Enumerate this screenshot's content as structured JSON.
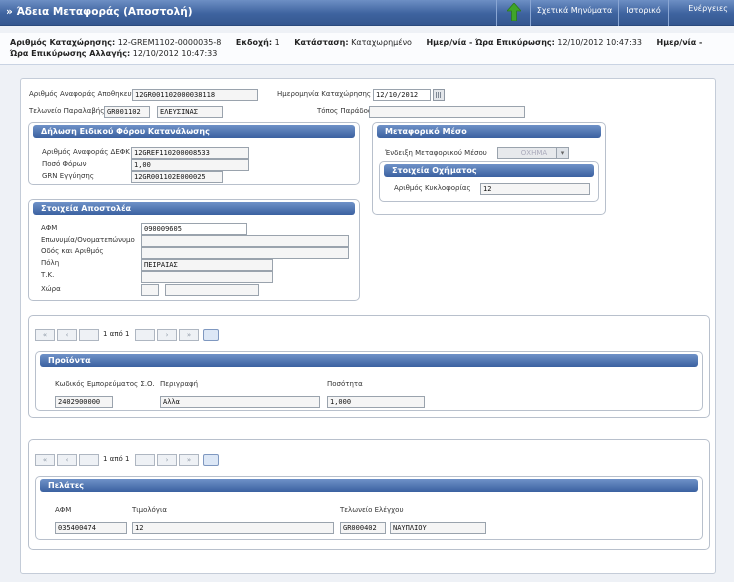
{
  "window": {
    "title": "» Άδεια Μεταφοράς (Αποστολή)",
    "toolbar": {
      "messages": "Σχετικά Μηνύματα",
      "history": "Ιστορικό",
      "actions": "Ενέργειες"
    }
  },
  "info": {
    "reg_no_label": "Αριθμός Καταχώρησης:",
    "reg_no": "12-GREM1102-0000035-8",
    "version_label": "Εκδοχή:",
    "version": "1",
    "status_label": "Κατάσταση:",
    "status": "Καταχωρημένο",
    "reg_date_label": "Ημερ/νία - Ώρα Επικύρωσης:",
    "reg_date": "12/10/2012 10:47:33",
    "mod_label_a": "Ημερ/νία -",
    "mod_label_b": "Ώρα Επικύρωσης Αλλαγής:",
    "mod_date": "12/10/2012 10:47:33"
  },
  "header": {
    "warehouse_ref_label": "Αριθμός Αναφοράς Αποθηκευτή",
    "warehouse_ref": "12GR001102000038118",
    "reg_date_label": "Ημερομηνία Καταχώρησης",
    "reg_date": "12/10/2012",
    "customs_label": "Τελωνείο Παραλαβής",
    "customs_code": "GR001102",
    "customs_name": "ΕΛΕΥΣΙΝΑΣ",
    "place_label": "Τόπος Παράδοσης",
    "place": ""
  },
  "tax": {
    "title": "Δήλωση Ειδικού Φόρου Κατανάλωσης",
    "ref_label": "Αριθμός Αναφοράς ΔΕΦΚ",
    "ref": "12GREF110200008533",
    "amount_label": "Ποσό Φόρων",
    "amount": "1,00",
    "grn_label": "GRN Εγγύησης",
    "grn": "12GR001102E000025"
  },
  "transport": {
    "title": "Μεταφορικό Μέσο",
    "means_label": "Ένδειξη Μεταφορικού Μέσου",
    "means": "ΟΧΗΜΑ",
    "vehicle_title": "Στοιχεία Οχήματος",
    "plate_label": "Αριθμός Κυκλοφορίας",
    "plate": "12"
  },
  "sender": {
    "title": "Στοιχεία Αποστολέα",
    "afm_label": "ΑΦΜ",
    "afm": "090009605",
    "name_label": "Επωνυμία/Ονοματεπώνυμο",
    "name": "",
    "street_label": "Οδός και Αριθμός",
    "street": "",
    "city_label": "Πόλη",
    "city": "ΠΕΙΡΑΙΑΣ",
    "zip_label": "Τ.Κ.",
    "zip": "",
    "country_label": "Χώρα",
    "country_code": "",
    "country_name": ""
  },
  "products": {
    "pager": {
      "first": "«",
      "prev": "‹",
      "page": "1 από 1",
      "next": "›",
      "last": "»"
    },
    "title": "Προϊόντα",
    "col_code": "Κωδικός Εμπορεύματος Σ.Ο.",
    "col_desc": "Περιγραφή",
    "col_qty": "Ποσότητα",
    "rows": [
      {
        "code": "2402900000",
        "desc": "Αλλα",
        "qty": "1,000"
      }
    ]
  },
  "clients": {
    "pager": {
      "first": "«",
      "prev": "‹",
      "page": "1 από 1",
      "next": "›",
      "last": "»"
    },
    "title": "Πελάτες",
    "col_afm": "ΑΦΜ",
    "col_invoice": "Τιμολόγια",
    "col_customs": "Τελωνείο Ελέγχου",
    "rows": [
      {
        "afm": "035400474",
        "invoice": "12",
        "customs_code": "GR000402",
        "customs_name": "ΝΑΥΠΛΙΟΥ"
      }
    ]
  },
  "icons": {
    "up_arrow": "green-up-arrow-icon",
    "calendar": "calendar-icon",
    "dropdown": "chevron-down-icon",
    "grid": "grid-view-icon"
  },
  "colors": {
    "header_blue": "#3e639f",
    "panel_header": "#4a6fac",
    "arrow_green": "#3fa52a"
  }
}
